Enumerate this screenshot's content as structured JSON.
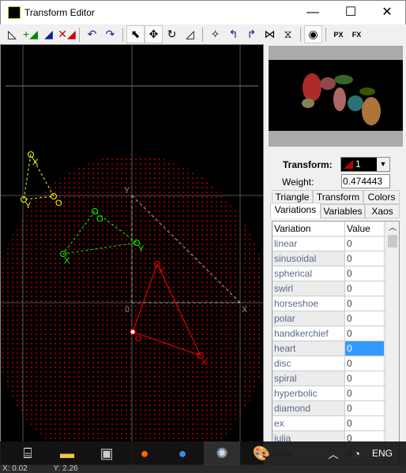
{
  "window": {
    "title": "Transform Editor",
    "minimize": "—",
    "maximize": "☐",
    "close": "✕"
  },
  "toolbar": [
    {
      "name": "new-transform",
      "glyph": "◺"
    },
    {
      "name": "add-transform",
      "glyph": "+◢"
    },
    {
      "name": "duplicate-transform",
      "glyph": "◢"
    },
    {
      "name": "delete-transform",
      "glyph": "✕◢"
    },
    {
      "sep": true
    },
    {
      "name": "undo",
      "glyph": "↶"
    },
    {
      "name": "redo",
      "glyph": "↷"
    },
    {
      "sep": true
    },
    {
      "name": "select",
      "glyph": "⬉",
      "active": true
    },
    {
      "name": "move",
      "glyph": "✥",
      "active": true
    },
    {
      "name": "rotate",
      "glyph": "↻"
    },
    {
      "name": "scale",
      "glyph": "◿"
    },
    {
      "sep": true
    },
    {
      "name": "reset",
      "glyph": "✧"
    },
    {
      "name": "rotate-left",
      "glyph": "↰"
    },
    {
      "name": "rotate-right",
      "glyph": "↱"
    },
    {
      "name": "flip-horizontal",
      "glyph": "⋈"
    },
    {
      "name": "flip-vertical",
      "glyph": "⧖"
    },
    {
      "sep": true
    },
    {
      "name": "show-variation-preview",
      "glyph": "◉",
      "active": true
    },
    {
      "sep": true
    },
    {
      "name": "post-transform",
      "glyph": "PX"
    },
    {
      "name": "add-post-transform",
      "glyph": "FX"
    }
  ],
  "canvas": {
    "axis_labels": {
      "origin": "0",
      "x": "X",
      "y": "Y"
    },
    "colors": {
      "transform1": "#ff0000",
      "transform2": "#00ff00",
      "transform3": "#ffff00",
      "reference": "#888888"
    },
    "triangle_labels": {
      "o": "O",
      "x": "X",
      "y": "Y"
    }
  },
  "panel": {
    "transform_label": "Transform:",
    "transform_value": "1",
    "weight_label": "Weight:",
    "weight_value": "0.474443",
    "tabs_row1": [
      "Triangle",
      "Transform",
      "Colors"
    ],
    "tabs_row2": [
      "Variations",
      "Variables",
      "Xaos"
    ],
    "active_tab": "Variations",
    "table": {
      "headers": [
        "Variation",
        "Value"
      ],
      "rows": [
        [
          "linear",
          "0"
        ],
        [
          "sinusoidal",
          "0"
        ],
        [
          "spherical",
          "0"
        ],
        [
          "swirl",
          "0"
        ],
        [
          "horseshoe",
          "0"
        ],
        [
          "polar",
          "0"
        ],
        [
          "handkerchief",
          "0"
        ],
        [
          "heart",
          "0"
        ],
        [
          "disc",
          "0"
        ],
        [
          "spiral",
          "0"
        ],
        [
          "hyperbolic",
          "0"
        ],
        [
          "diamond",
          "0"
        ],
        [
          "ex",
          "0"
        ],
        [
          "julia",
          "0"
        ],
        [
          "bent",
          "0"
        ]
      ],
      "selected": "heart"
    }
  },
  "taskbar": {
    "tray": "ENG",
    "apps": [
      "task-view",
      "file-explorer",
      "media-app",
      "firefox",
      "thunderbird",
      "apophysis",
      "paint"
    ]
  },
  "status": {
    "x": "X: 0.02",
    "y": "Y: 2.26"
  }
}
